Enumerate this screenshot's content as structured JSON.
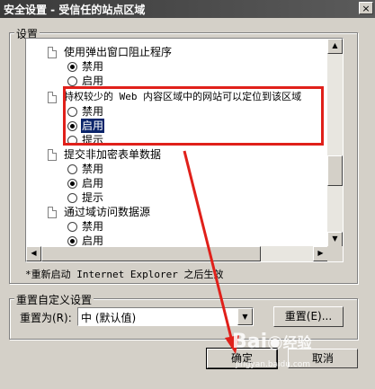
{
  "window": {
    "title": "安全设置 - 受信任的站点区域",
    "close_glyph": "×"
  },
  "settings_group": {
    "label": "设置"
  },
  "settings_items": [
    {
      "heading": "使用弹出窗口阻止程序",
      "options": [
        "禁用",
        "启用"
      ],
      "selected": 0
    },
    {
      "heading": "特权较少的 Web 内容区域中的网站可以定位到该区域",
      "options": [
        "禁用",
        "启用",
        "提示"
      ],
      "selected": 1
    },
    {
      "heading": "提交非加密表单数据",
      "options": [
        "禁用",
        "启用",
        "提示"
      ],
      "selected": 1
    },
    {
      "heading": "通过域访问数据源",
      "options": [
        "禁用",
        "启用"
      ],
      "selected": 1
    }
  ],
  "restart_note": "*重新启动 Internet Explorer 之后生效",
  "reset_group": {
    "label": "重置自定义设置",
    "reset_to_label": "重置为(R):",
    "combo_value": "中 (默认值)",
    "reset_button": "重置(E)..."
  },
  "footer": {
    "ok": "确定",
    "cancel": "取消"
  },
  "watermark": {
    "brand": "Bai",
    "brand_suffix": "经验",
    "url": "jingyan.baidu.com"
  },
  "colors": {
    "highlight": "#0a246a",
    "annotation_red": "#e0201a",
    "dialog_bg": "#d4d0c8"
  }
}
